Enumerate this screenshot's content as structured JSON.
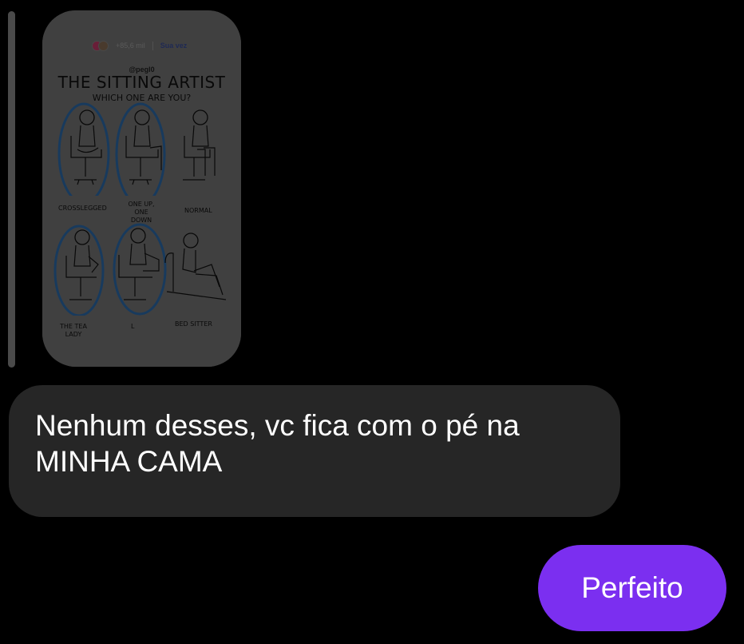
{
  "shared_post": {
    "meta": {
      "views": "+85,6 mil",
      "your_turn": "Sua vez"
    },
    "handle": "@pegl0",
    "title": "THE SITTING ARTIST",
    "subtitle": "WHICH ONE ARE YOU?",
    "captions": {
      "crosslegged": "CROSSLEGGED",
      "one_up_one_down": "ONE UP, ONE DOWN",
      "normal": "NORMAL",
      "the_tea_lady": "THE TEA LADY",
      "l": "L",
      "bed_sitter": "BED SITTER"
    },
    "colors": {
      "circle": "#2f6fb0",
      "ink": "#111111"
    }
  },
  "messages": {
    "incoming": "Nenhum desses, vc fica com o pé na MINHA CAMA",
    "outgoing": "Perfeito"
  },
  "colors": {
    "background": "#000000",
    "incoming_bubble": "#262626",
    "outgoing_bubble": "#7b2ff0"
  }
}
